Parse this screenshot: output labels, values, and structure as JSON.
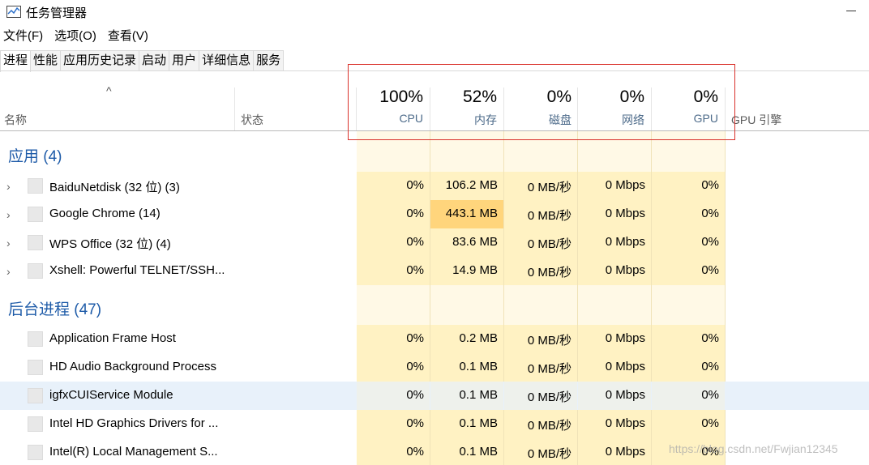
{
  "window": {
    "title": "任务管理器",
    "icon": "task-manager-icon"
  },
  "menu": [
    "文件(F)",
    "选项(O)",
    "查看(V)"
  ],
  "tabs": [
    "进程",
    "性能",
    "应用历史记录",
    "启动",
    "用户",
    "详细信息",
    "服务"
  ],
  "active_tab": "进程",
  "columns": {
    "name": "名称",
    "status": "状态",
    "cpu": {
      "percent": "100%",
      "label": "CPU"
    },
    "memory": {
      "percent": "52%",
      "label": "内存"
    },
    "disk": {
      "percent": "0%",
      "label": "磁盘"
    },
    "network": {
      "percent": "0%",
      "label": "网络"
    },
    "gpu": {
      "percent": "0%",
      "label": "GPU"
    },
    "gpu_engine": "GPU 引擎"
  },
  "groups": [
    {
      "title": "应用 (4)",
      "rows": [
        {
          "name": "BaiduNetdisk (32 位) (3)",
          "cpu": "0%",
          "memory": "106.2 MB",
          "disk": "0 MB/秒",
          "network": "0 Mbps",
          "gpu": "0%",
          "expandable": true
        },
        {
          "name": "Google Chrome (14)",
          "cpu": "0%",
          "memory": "443.1 MB",
          "disk": "0 MB/秒",
          "network": "0 Mbps",
          "gpu": "0%",
          "expandable": true
        },
        {
          "name": "WPS Office (32 位) (4)",
          "cpu": "0%",
          "memory": "83.6 MB",
          "disk": "0 MB/秒",
          "network": "0 Mbps",
          "gpu": "0%",
          "expandable": true
        },
        {
          "name": "Xshell: Powerful TELNET/SSH...",
          "cpu": "0%",
          "memory": "14.9 MB",
          "disk": "0 MB/秒",
          "network": "0 Mbps",
          "gpu": "0%",
          "expandable": true
        }
      ]
    },
    {
      "title": "后台进程 (47)",
      "rows": [
        {
          "name": "Application Frame Host",
          "cpu": "0%",
          "memory": "0.2 MB",
          "disk": "0 MB/秒",
          "network": "0 Mbps",
          "gpu": "0%",
          "expandable": false
        },
        {
          "name": "HD Audio Background Process",
          "cpu": "0%",
          "memory": "0.1 MB",
          "disk": "0 MB/秒",
          "network": "0 Mbps",
          "gpu": "0%",
          "expandable": false
        },
        {
          "name": "igfxCUIService Module",
          "cpu": "0%",
          "memory": "0.1 MB",
          "disk": "0 MB/秒",
          "network": "0 Mbps",
          "gpu": "0%",
          "expandable": false
        },
        {
          "name": "Intel HD Graphics Drivers for ...",
          "cpu": "0%",
          "memory": "0.1 MB",
          "disk": "0 MB/秒",
          "network": "0 Mbps",
          "gpu": "0%",
          "expandable": false
        },
        {
          "name": "Intel(R) Local Management S...",
          "cpu": "0%",
          "memory": "0.1 MB",
          "disk": "0 MB/秒",
          "network": "0 Mbps",
          "gpu": "0%",
          "expandable": false
        }
      ]
    }
  ],
  "watermark": "https://blog.csdn.net/Fwjian12345",
  "colors": {
    "group_title": "#1e5ba8",
    "heat_cell": "#fff2c3",
    "heat_cell_hot": "#ffd57c",
    "annotation_box": "#d9312b",
    "selected_row": "#e8f1fa"
  }
}
